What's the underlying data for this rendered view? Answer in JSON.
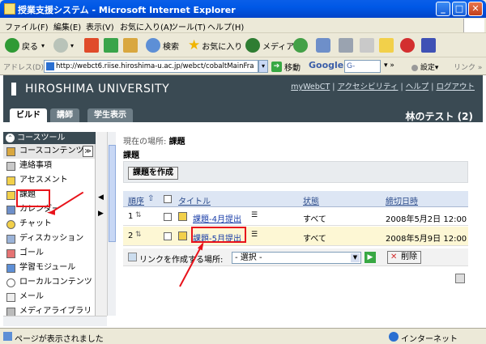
{
  "window": {
    "title": "授業支援システム - Microsoft Internet Explorer"
  },
  "menu": [
    "ファイル(F)",
    "編集(E)",
    "表示(V)",
    "お気に入り(A)",
    "ツール(T)",
    "ヘルプ(H)"
  ],
  "toolbar": {
    "back": "戻る",
    "search": "検索",
    "favorites": "お気に入り",
    "media": "メディア"
  },
  "address": {
    "label": "アドレス(D)",
    "url": "http://webct6.riise.hiroshima-u.ac.jp/webct/cobaltMainFra",
    "go": "移動",
    "google": "Google",
    "google_box": "G-",
    "settings": "設定▾",
    "links": "リンク »"
  },
  "header": {
    "university": "HIROSHIMA UNIVERSITY",
    "links": [
      "myWebCT",
      "アクセシビリティ",
      "ヘルプ",
      "ログアウト"
    ],
    "tabs": [
      "ビルド",
      "講師",
      "学生表示"
    ],
    "course": "林のテスト (2)"
  },
  "sidebar": {
    "heading": "コースツール",
    "items": [
      "コースコンテンツ",
      "連絡事項",
      "アセスメント",
      "課題",
      "カレンダー",
      "チャット",
      "ディスカッション",
      "ゴール",
      "学習モジュール",
      "ローカルコンテンツ",
      "メール",
      "メディアライブラリ"
    ]
  },
  "main": {
    "location_label": "現在の場所:",
    "location_value": "課題",
    "title": "課題",
    "create_button": "課題を作成",
    "columns": [
      "順序",
      "タイトル",
      "状態",
      "締切日時"
    ],
    "rows": [
      {
        "order": "1",
        "title": "課題-4月提出",
        "status": "すべて",
        "deadline": "2008年5月2日 12:00"
      },
      {
        "order": "2",
        "title": "課題-5月提出",
        "status": "すべて",
        "deadline": "2008年5月9日 12:00"
      }
    ],
    "link_label": "リンクを作成する場所:",
    "select_value": "- 選択 -",
    "delete_button": "削除"
  },
  "status": {
    "text": "ページが表示されました",
    "zone": "インターネット"
  }
}
